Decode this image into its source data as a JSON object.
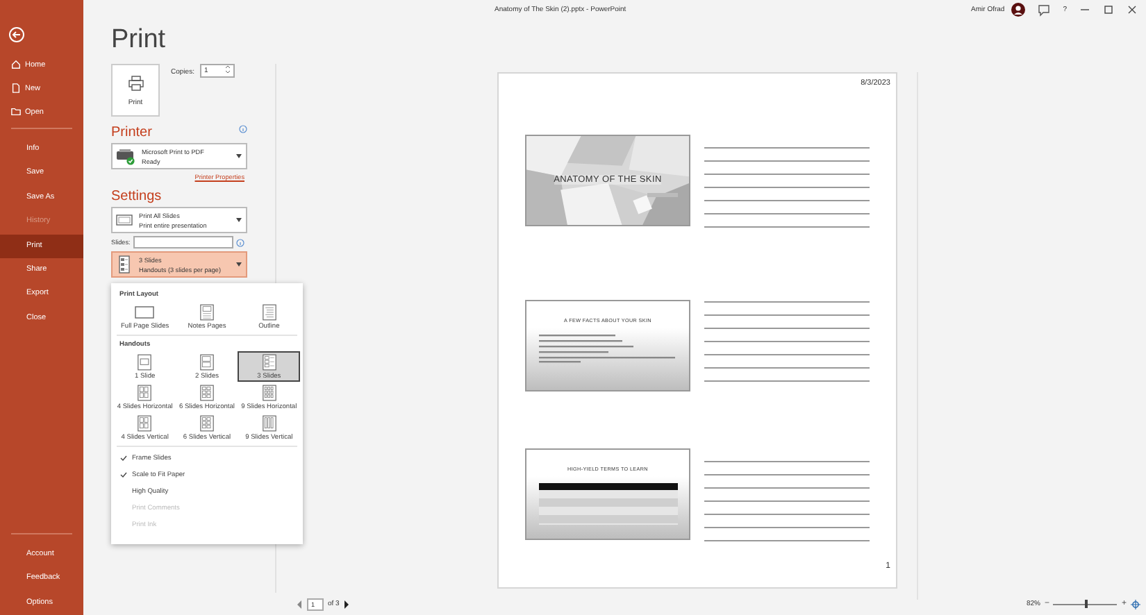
{
  "window": {
    "title": "Anatomy of The Skin (2).pptx  -  PowerPoint",
    "user": "Amir Ofrad",
    "help": "?"
  },
  "sidebar": {
    "top": [
      {
        "label": "Home"
      },
      {
        "label": "New"
      },
      {
        "label": "Open"
      }
    ],
    "items": [
      {
        "label": "Info",
        "selected": false,
        "disabled": false
      },
      {
        "label": "Save",
        "selected": false,
        "disabled": false
      },
      {
        "label": "Save As",
        "selected": false,
        "disabled": false
      },
      {
        "label": "History",
        "selected": false,
        "disabled": true
      },
      {
        "label": "Print",
        "selected": true,
        "disabled": false
      },
      {
        "label": "Share",
        "selected": false,
        "disabled": false
      },
      {
        "label": "Export",
        "selected": false,
        "disabled": false
      },
      {
        "label": "Close",
        "selected": false,
        "disabled": false
      }
    ],
    "bottom": [
      "Account",
      "Feedback",
      "Options"
    ]
  },
  "print": {
    "heading": "Print",
    "button": "Print",
    "copies_label": "Copies:",
    "copies": "1"
  },
  "printer": {
    "heading": "Printer",
    "name": "Microsoft Print to PDF",
    "status": "Ready",
    "properties_link": "Printer Properties"
  },
  "settings": {
    "heading": "Settings",
    "slides_label": "Slides:",
    "dropdowns": [
      {
        "line1": "Print All Slides",
        "line2": "Print entire presentation",
        "open": false
      },
      {
        "line1": "3 Slides",
        "line2": "Handouts (3 slides per page)",
        "open": true
      }
    ]
  },
  "layout_menu": {
    "sections": [
      {
        "heading": "Print Layout",
        "options": [
          {
            "label": "Full Page Slides",
            "kind": "full",
            "selected": false
          },
          {
            "label": "Notes Pages",
            "kind": "notes",
            "selected": false
          },
          {
            "label": "Outline",
            "kind": "outline",
            "selected": false
          }
        ]
      },
      {
        "heading": "Handouts",
        "options": [
          {
            "label": "1 Slide",
            "kind": "h1",
            "selected": false
          },
          {
            "label": "2 Slides",
            "kind": "h2",
            "selected": false
          },
          {
            "label": "3 Slides",
            "kind": "h3",
            "selected": true
          },
          {
            "label": "4 Slides Horizontal",
            "kind": "g4",
            "selected": false
          },
          {
            "label": "6 Slides Horizontal",
            "kind": "g6",
            "selected": false
          },
          {
            "label": "9 Slides Horizontal",
            "kind": "g9",
            "selected": false
          },
          {
            "label": "4 Slides Vertical",
            "kind": "g4",
            "selected": false
          },
          {
            "label": "6 Slides Vertical",
            "kind": "g6",
            "selected": false
          },
          {
            "label": "9 Slides Vertical",
            "kind": "v9",
            "selected": false
          }
        ]
      }
    ],
    "checks": [
      {
        "label": "Frame Slides",
        "checked": true,
        "disabled": false
      },
      {
        "label": "Scale to Fit Paper",
        "checked": true,
        "disabled": false
      },
      {
        "label": "High Quality",
        "checked": false,
        "disabled": false
      },
      {
        "label": "Print Comments",
        "checked": false,
        "disabled": true
      },
      {
        "label": "Print Ink",
        "checked": false,
        "disabled": true
      }
    ]
  },
  "preview": {
    "date": "8/3/2023",
    "page_number": "1",
    "slides": [
      {
        "kind": "title",
        "title": "ANATOMY OF THE SKIN"
      },
      {
        "kind": "bullets",
        "title": "A FEW FACTS ABOUT YOUR SKIN"
      },
      {
        "kind": "table",
        "title": "HIGH-YIELD TERMS TO LEARN"
      }
    ]
  },
  "footer": {
    "page": "1",
    "of": "of 3",
    "zoom": "82%",
    "zoom_out": "−",
    "zoom_in": "+",
    "level": 0.5
  }
}
